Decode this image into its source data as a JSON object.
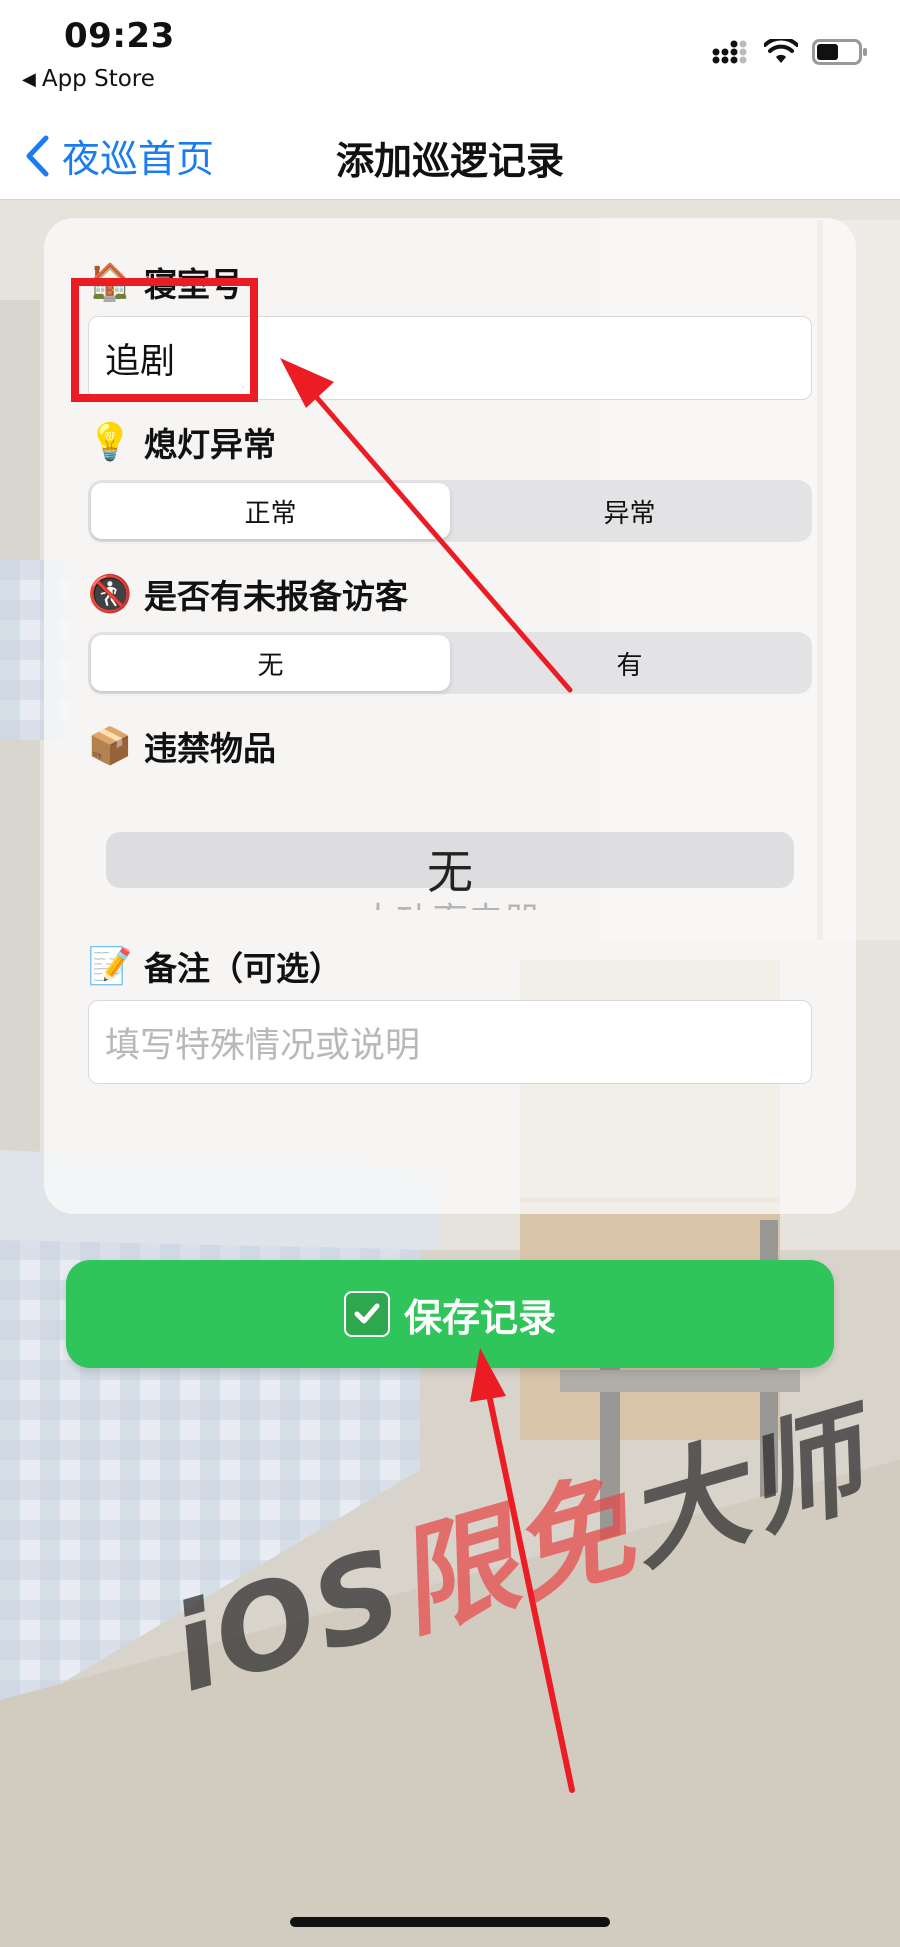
{
  "status_bar": {
    "time": "09:23",
    "back_app": "App Store"
  },
  "nav": {
    "back_label": "夜巡首页",
    "title": "添加巡逻记录"
  },
  "form": {
    "dorm": {
      "icon": "house-emoji",
      "label": "寝室号",
      "value": "追剧"
    },
    "lights_out": {
      "icon": "lightbulb-emoji",
      "label": "熄灯异常",
      "options": [
        "正常",
        "异常"
      ],
      "selected": "正常"
    },
    "visitor": {
      "icon": "no-pedestrians-emoji",
      "label": "是否有未报备访客",
      "options": [
        "无",
        "有"
      ],
      "selected": "无"
    },
    "contraband": {
      "icon": "package-emoji",
      "label": "违禁物品",
      "selected": "无",
      "next_option": "大功率电器"
    },
    "notes": {
      "icon": "memo-emoji",
      "label": "备注（可选）",
      "placeholder": "填写特殊情况或说明"
    }
  },
  "save_button": {
    "icon": "check-mark-button-emoji",
    "label": "保存记录"
  },
  "watermark": {
    "part1": "iOS",
    "part2": "限免",
    "part3": "大师"
  },
  "colors": {
    "accent_blue": "#1a7cf0",
    "save_green": "#30c55b",
    "highlight_red": "#ec1c24"
  }
}
